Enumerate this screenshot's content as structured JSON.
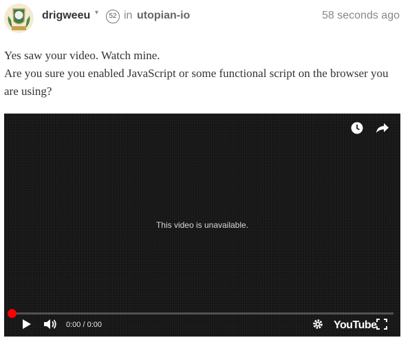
{
  "post": {
    "author": "drigweeu",
    "reputation": "52",
    "in_label": "in",
    "community": "utopian-io",
    "time_ago": "58 seconds ago"
  },
  "body": {
    "line1": "Yes saw your video. Watch mine.",
    "line2": "Are you sure you enabled JavaScript or some functional script on the browser you are using?"
  },
  "video": {
    "message": "This video is unavailable.",
    "time_display": "0:00 / 0:00",
    "brand": "YouTube",
    "progress": 0,
    "icons": [
      "watch-later-icon",
      "share-icon",
      "play-icon",
      "volume-icon",
      "settings-icon",
      "fullscreen-icon"
    ]
  },
  "colors": {
    "progress": "#ff0000",
    "video_bg": "#151515",
    "text": "#333333",
    "muted": "#888888"
  }
}
